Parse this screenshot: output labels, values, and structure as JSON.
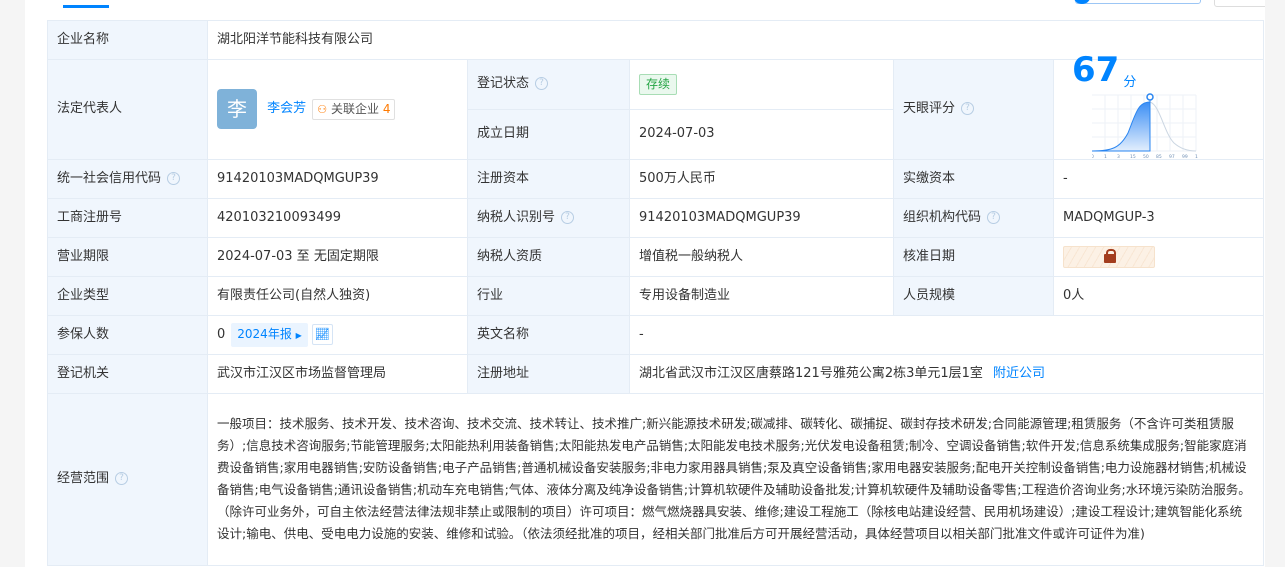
{
  "company_name_label": "企业名称",
  "company_name": "湖北阳洋节能科技有限公司",
  "legal_rep": {
    "label": "法定代表人",
    "avatar_char": "李",
    "name": "李会芳",
    "related_label": "关联企业",
    "related_count": "4"
  },
  "reg_status": {
    "label": "登记状态",
    "value": "存续"
  },
  "found_date": {
    "label": "成立日期",
    "value": "2024-07-03"
  },
  "tianyan_score": {
    "label": "天眼评分",
    "value": "67",
    "unit": "分",
    "axis_ticks": [
      "0",
      "1",
      "3",
      "15",
      "50",
      "85",
      "97",
      "99",
      "100"
    ]
  },
  "credit_code": {
    "label": "统一社会信用代码",
    "value": "91420103MADQMGUP39"
  },
  "reg_capital": {
    "label": "注册资本",
    "value": "500万人民币"
  },
  "paid_capital": {
    "label": "实缴资本",
    "value": "-"
  },
  "biz_reg_no": {
    "label": "工商注册号",
    "value": "420103210093499"
  },
  "taxpayer_id": {
    "label": "纳税人识别号",
    "value": "91420103MADQMGUP39"
  },
  "org_code": {
    "label": "组织机构代码",
    "value": "MADQMGUP-3"
  },
  "biz_term": {
    "label": "营业期限",
    "value": "2024-07-03 至 无固定期限"
  },
  "taxpayer_qual": {
    "label": "纳税人资质",
    "value": "增值税一般纳税人"
  },
  "approve_date": {
    "label": "核准日期"
  },
  "company_type": {
    "label": "企业类型",
    "value": "有限责任公司(自然人独资)"
  },
  "industry": {
    "label": "行业",
    "value": "专用设备制造业"
  },
  "staff_size": {
    "label": "人员规模",
    "value": "0人"
  },
  "insured": {
    "label": "参保人数",
    "value": "0",
    "report": "2024年报"
  },
  "english_name": {
    "label": "英文名称",
    "value": "-"
  },
  "reg_authority": {
    "label": "登记机关",
    "value": "武汉市江汉区市场监督管理局"
  },
  "reg_address": {
    "label": "注册地址",
    "value": "湖北省武汉市江汉区唐蔡路121号雅苑公寓2栋3单元1层1室",
    "nearby": "附近公司"
  },
  "scope": {
    "label": "经营范围",
    "value": "一般项目：技术服务、技术开发、技术咨询、技术交流、技术转让、技术推广;新兴能源技术研发;碳减排、碳转化、碳捕捉、碳封存技术研发;合同能源管理;租赁服务（不含许可类租赁服务）;信息技术咨询服务;节能管理服务;太阳能热利用装备销售;太阳能热发电产品销售;太阳能发电技术服务;光伏发电设备租赁;制冷、空调设备销售;软件开发;信息系统集成服务;智能家庭消费设备销售;家用电器销售;安防设备销售;电子产品销售;普通机械设备安装服务;非电力家用器具销售;泵及真空设备销售;家用电器安装服务;配电开关控制设备销售;电力设施器材销售;机械设备销售;电气设备销售;通讯设备销售;机动车充电销售;气体、液体分离及纯净设备销售;计算机软硬件及辅助设备批发;计算机软硬件及辅助设备零售;工程造价咨询业务;水环境污染防治服务。（除许可业务外，可自主依法经营法律法规非禁止或限制的项目）许可项目：燃气燃烧器具安装、维修;建设工程施工（除核电站建设经营、民用机场建设）;建设工程设计;建筑智能化系统设计;输电、供电、受电电力设施的安装、维修和试验。（依法须经批准的项目，经相关部门批准后方可开展经营活动，具体经营项目以相关部门批准文件或许可证件为准)"
  },
  "colors": {
    "accent": "#0084ff",
    "label_bg": "#f0f6fd",
    "status_green": "#26a545"
  }
}
